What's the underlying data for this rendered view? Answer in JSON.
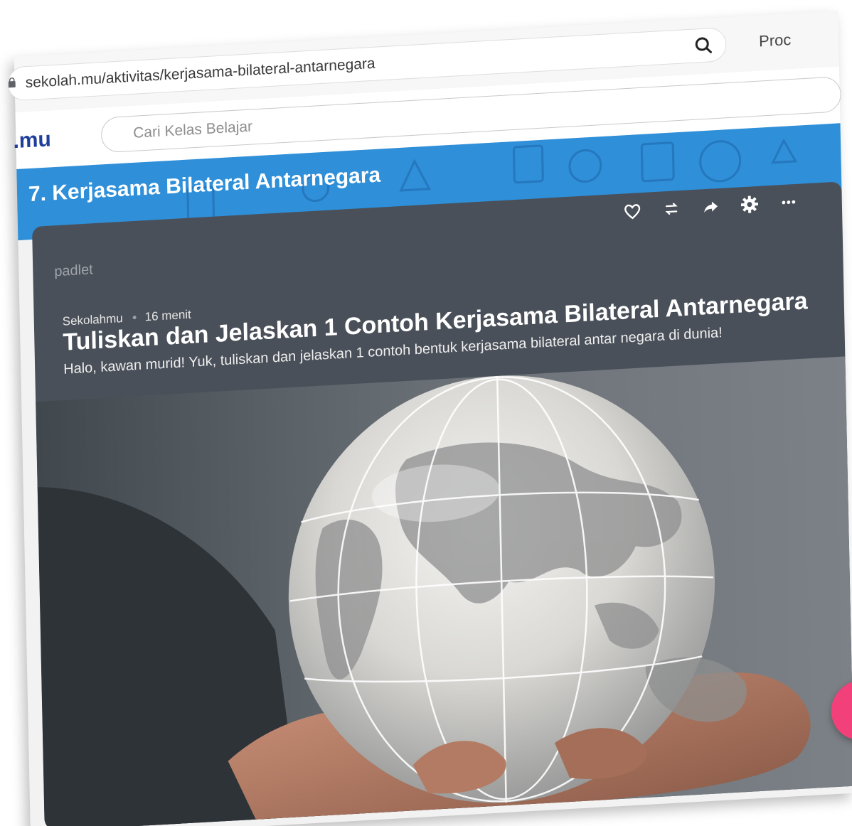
{
  "browser": {
    "url": "sekolah.mu/aktivitas/kerjasama-bilateral-antarnegara",
    "product_link": "Proc"
  },
  "site": {
    "logo": ".mu",
    "search_placeholder": "Cari Kelas Belajar"
  },
  "banner": {
    "title": "7. Kerjasama Bilateral Antarnegara"
  },
  "padlet": {
    "brand": "padlet",
    "toolbar": [
      "heart-icon",
      "remake-icon",
      "share-icon",
      "settings-icon",
      "more-icon"
    ],
    "author": "Sekolahmu",
    "time": "16 menit",
    "title": "Tuliskan dan Jelaskan 1 Contoh Kerjasama Bilateral Antarnegara",
    "description": "Halo, kawan murid! Yuk, tuliskan dan jelaskan 1 contoh bentuk kerjasama bilateral antar negara di dunia!"
  },
  "fab": {
    "label": "+",
    "color": "#f1407a"
  },
  "colors": {
    "banner": "#2f8fd8",
    "panel": "#4a5059",
    "logo": "#1f3f9c"
  }
}
